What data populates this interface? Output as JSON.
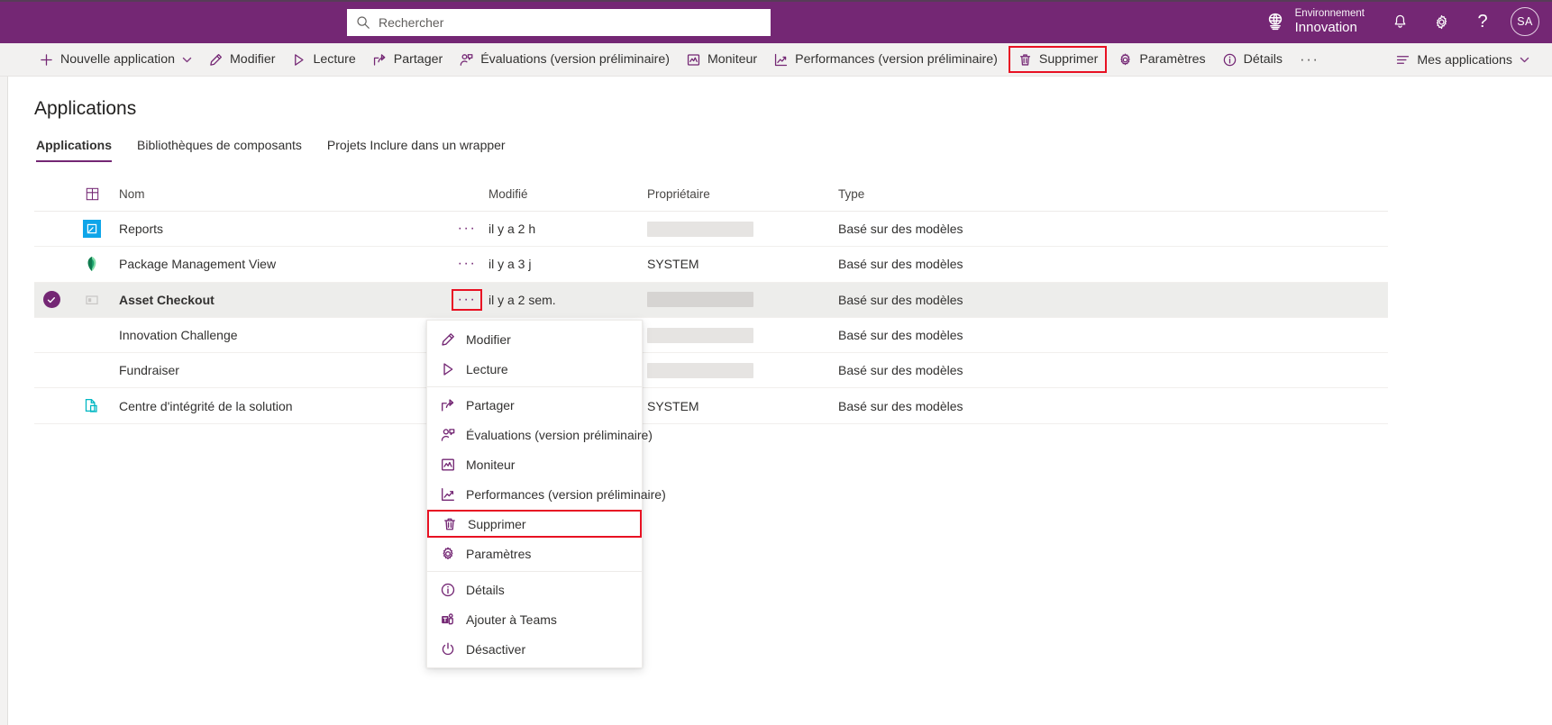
{
  "theme": {
    "brand_purple": "#742774",
    "command_bar_bg": "#f2f1f0",
    "highlight_red": "#e81123",
    "selected_row_bg": "#ededeb"
  },
  "topbar": {
    "search": {
      "placeholder": "Rechercher",
      "value": "",
      "icon": "search-icon"
    },
    "environment": {
      "label": "Environnement",
      "name": "Innovation",
      "icon": "globe-icon"
    },
    "actions": [
      {
        "name": "notifications-button",
        "icon": "bell-icon"
      },
      {
        "name": "settings-button",
        "icon": "gear-icon"
      },
      {
        "name": "help-button",
        "icon": "question-mark-icon",
        "glyph": "?"
      }
    ],
    "avatar": {
      "initials": "SA"
    }
  },
  "commandbar": {
    "items": [
      {
        "label": "Nouvelle application",
        "icon": "plus-icon",
        "chevron": true,
        "highlighted": false
      },
      {
        "label": "Modifier",
        "icon": "pencil-icon",
        "chevron": false,
        "highlighted": false
      },
      {
        "label": "Lecture",
        "icon": "play-icon",
        "chevron": false,
        "highlighted": false
      },
      {
        "label": "Partager",
        "icon": "share-icon",
        "chevron": false,
        "highlighted": false
      },
      {
        "label": "Évaluations (version préliminaire)",
        "icon": "person-feedback-icon",
        "chevron": false,
        "highlighted": false
      },
      {
        "label": "Moniteur",
        "icon": "monitor-chart-icon",
        "chevron": false,
        "highlighted": false
      },
      {
        "label": "Performances (version préliminaire)",
        "icon": "trend-chart-icon",
        "chevron": false,
        "highlighted": false
      },
      {
        "label": "Supprimer",
        "icon": "trash-icon",
        "chevron": false,
        "highlighted": true
      },
      {
        "label": "Paramètres",
        "icon": "gear-icon",
        "chevron": false,
        "highlighted": false
      },
      {
        "label": "Détails",
        "icon": "info-icon",
        "chevron": false,
        "highlighted": false
      }
    ],
    "overflow": "···",
    "right": {
      "label": "Mes applications",
      "icon": "list-filter-icon",
      "chevron": true
    }
  },
  "main": {
    "title": "Applications",
    "tabs": [
      {
        "label": "Applications",
        "active": true
      },
      {
        "label": "Bibliothèques de composants",
        "active": false
      },
      {
        "label": "Projets Inclure dans un wrapper",
        "active": false
      }
    ],
    "table": {
      "columns": [
        "Nom",
        "Modifié",
        "Propriétaire",
        "Type"
      ],
      "rows": [
        {
          "name": "Reports",
          "modified": "il y a 2 h",
          "owner": "",
          "owner_redacted": true,
          "type": "Basé sur des modèles",
          "icon": "app-blue-icon",
          "selected": false,
          "dots_highlighted": false
        },
        {
          "name": "Package Management View",
          "modified": "il y a 3 j",
          "owner": "SYSTEM",
          "owner_redacted": false,
          "type": "Basé sur des modèles",
          "icon": "app-green-leaf-icon",
          "selected": false,
          "dots_highlighted": false
        },
        {
          "name": "Asset Checkout",
          "modified": "il y a 2 sem.",
          "owner": "",
          "owner_redacted": true,
          "type": "Basé sur des modèles",
          "icon": "app-outline-icon",
          "selected": true,
          "dots_highlighted": true
        },
        {
          "name": "Innovation Challenge",
          "modified": "",
          "owner": "",
          "owner_redacted": true,
          "type": "Basé sur des modèles",
          "icon": "app-none-icon",
          "selected": false,
          "dots_highlighted": false
        },
        {
          "name": "Fundraiser",
          "modified": "",
          "owner": "",
          "owner_redacted": true,
          "type": "Basé sur des modèles",
          "icon": "app-none-icon",
          "selected": false,
          "dots_highlighted": false
        },
        {
          "name": "Centre d'intégrité de la solution",
          "modified": "",
          "owner": "SYSTEM",
          "owner_redacted": false,
          "type": "Basé sur des modèles",
          "icon": "app-doc-copy-icon",
          "selected": false,
          "dots_highlighted": false
        }
      ]
    }
  },
  "contextmenu": {
    "items": [
      {
        "label": "Modifier",
        "icon": "pencil-icon",
        "highlighted": false,
        "separator_after": false
      },
      {
        "label": "Lecture",
        "icon": "play-icon",
        "highlighted": false,
        "separator_after": true
      },
      {
        "label": "Partager",
        "icon": "share-icon",
        "highlighted": false,
        "separator_after": false
      },
      {
        "label": "Évaluations (version préliminaire)",
        "icon": "person-feedback-icon",
        "highlighted": false,
        "separator_after": false
      },
      {
        "label": "Moniteur",
        "icon": "monitor-chart-icon",
        "highlighted": false,
        "separator_after": false
      },
      {
        "label": "Performances (version préliminaire)",
        "icon": "trend-chart-icon",
        "highlighted": false,
        "separator_after": false
      },
      {
        "label": "Supprimer",
        "icon": "trash-icon",
        "highlighted": true,
        "separator_after": false
      },
      {
        "label": "Paramètres",
        "icon": "gear-icon",
        "highlighted": false,
        "separator_after": true
      },
      {
        "label": "Détails",
        "icon": "info-icon",
        "highlighted": false,
        "separator_after": false
      },
      {
        "label": "Ajouter à Teams",
        "icon": "teams-icon",
        "highlighted": false,
        "separator_after": false
      },
      {
        "label": "Désactiver",
        "icon": "power-icon",
        "highlighted": false,
        "separator_after": false
      }
    ]
  }
}
